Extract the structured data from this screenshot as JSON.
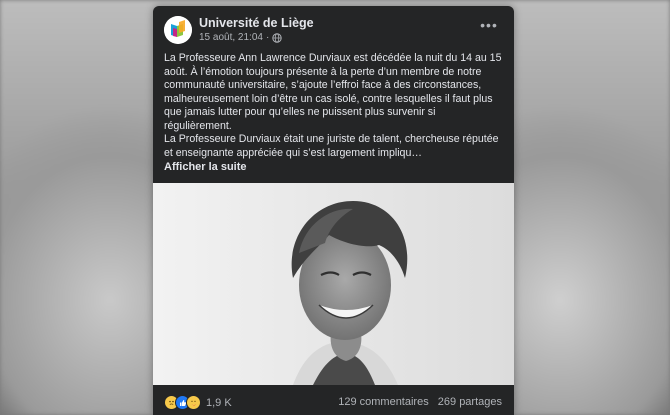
{
  "post": {
    "page_name": "Université de Liège",
    "date": "15 août, 21:04",
    "meta_separator": "·",
    "paragraph_1": "La Professeure Ann Lawrence Durviaux est décédée la nuit du 14 au 15 août. À l’émotion toujours présente à la perte d’un membre de notre communauté universitaire, s’ajoute l’effroi face à des circonstances, malheureusement loin d’être un cas isolé, contre lesquelles il faut plus que jamais lutter pour qu’elles ne puissent plus survenir si régulièrement.",
    "paragraph_2": "La Professeure Durviaux était une juriste de talent, chercheuse réputée et enseignante appréciée qui s’est largement impliqu…",
    "see_more": "Afficher la suite",
    "more_glyph": "•••"
  },
  "footer": {
    "reaction_icons": [
      "sad-reaction-icon",
      "like-reaction-icon",
      "care-reaction-icon"
    ],
    "reaction_count": "1,9 K",
    "comments": "129 commentaires",
    "shares": "269 partages"
  },
  "colors": {
    "card_bg": "#242526",
    "text_primary": "#e4e6eb",
    "text_secondary": "#b0b3b8",
    "like_blue": "#2078f4",
    "sad_yellow": "#f7c94b"
  }
}
